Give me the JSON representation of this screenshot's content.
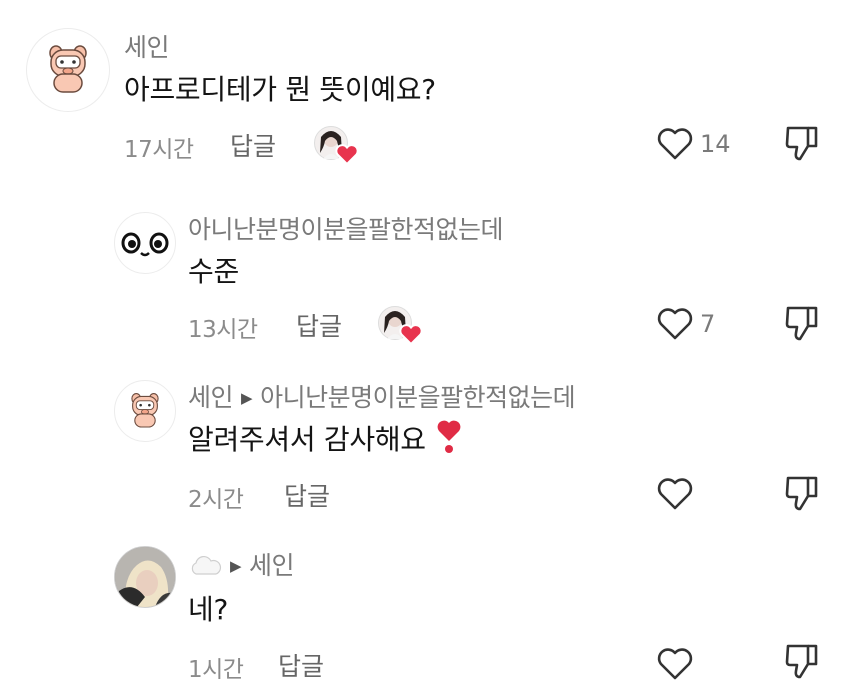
{
  "comments": [
    {
      "username": "세인",
      "reply_to": "",
      "text": "아프로디테가 뭔 뜻이예요?",
      "time": "17시간",
      "reply_label": "답글",
      "likes": "14",
      "creator_liked": true
    },
    {
      "username": "아니난분명이분을팔한적없는데",
      "reply_to": "",
      "text": "수준",
      "time": "13시간",
      "reply_label": "답글",
      "likes": "7",
      "creator_liked": true
    },
    {
      "username": "세인",
      "reply_to": "아니난분명이분을팔한적없는데",
      "text": "알려주셔서 감사해요",
      "time": "2시간",
      "reply_label": "답글",
      "likes": "",
      "creator_liked": false
    },
    {
      "username": "",
      "reply_to": "세인",
      "text": "네?",
      "time": "1시간",
      "reply_label": "답글",
      "likes": "",
      "creator_liked": false
    }
  ],
  "icons": {
    "heart": "heart-outline-icon",
    "dislike": "thumbs-down-icon",
    "reply_arrow": "triangle-right-icon",
    "emoji": "red-exclamation-heart-emoji",
    "cloud": "cloud-emoji"
  },
  "colors": {
    "heart_red": "#e8344e",
    "meta_gray": "#8b8b8b",
    "icon_dark": "#333333"
  }
}
